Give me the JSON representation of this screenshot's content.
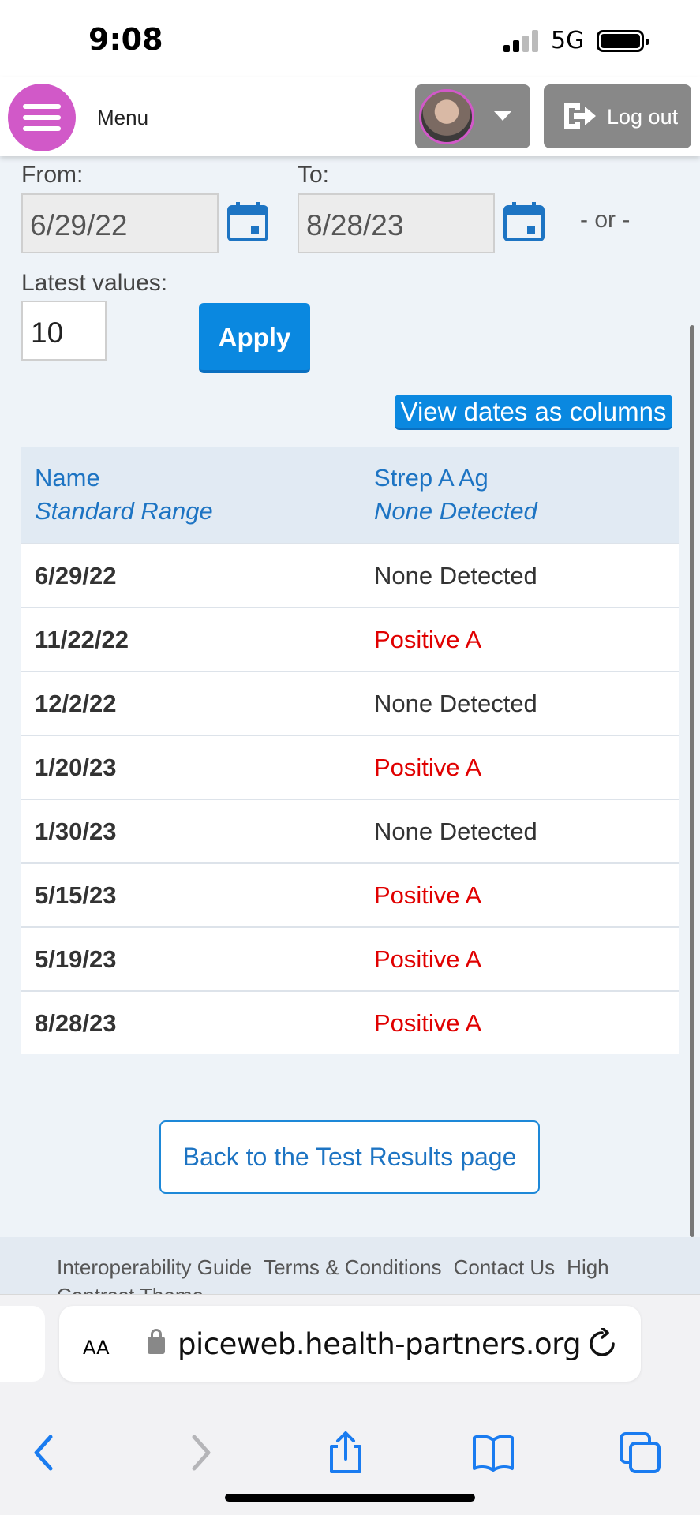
{
  "status_bar": {
    "time": "9:08",
    "network": "5G"
  },
  "header": {
    "menu_label": "Menu",
    "logout_label": "Log out",
    "colors": {
      "menu_button": "#d159c8",
      "header_button": "#888888"
    }
  },
  "filters": {
    "from_label": "From:",
    "from_value": "6/29/22",
    "to_label": "To:",
    "to_value": "8/28/23",
    "or_text": "- or -",
    "latest_label": "Latest values:",
    "latest_value": "10",
    "apply_label": "Apply"
  },
  "view_toggle_label": "View dates as columns",
  "table": {
    "header": {
      "name_label": "Name",
      "name_sub": "Standard Range",
      "test_label": "Strep A Ag",
      "test_sub": "None Detected"
    },
    "rows": [
      {
        "date": "6/29/22",
        "value": "None Detected",
        "abnormal": false
      },
      {
        "date": "11/22/22",
        "value": "Positive A",
        "abnormal": true
      },
      {
        "date": "12/2/22",
        "value": "None Detected",
        "abnormal": false
      },
      {
        "date": "1/20/23",
        "value": "Positive A",
        "abnormal": true
      },
      {
        "date": "1/30/23",
        "value": "None Detected",
        "abnormal": false
      },
      {
        "date": "5/15/23",
        "value": "Positive A",
        "abnormal": true
      },
      {
        "date": "5/19/23",
        "value": "Positive A",
        "abnormal": true
      },
      {
        "date": "8/28/23",
        "value": "Positive A",
        "abnormal": true
      }
    ],
    "colors": {
      "abnormal": "#e00000",
      "header_text": "#1d74c3",
      "accent": "#0a88e0"
    }
  },
  "back_button_label": "Back to the Test Results page",
  "footer": {
    "links": [
      "Interoperability Guide",
      "Terms & Conditions",
      "Contact Us",
      "High Contrast Theme"
    ]
  },
  "browser": {
    "text_size_label": "AA",
    "url": "piceweb.health-partners.org",
    "icons": [
      "back-icon",
      "forward-icon",
      "share-icon",
      "bookmarks-icon",
      "tabs-icon",
      "reload-icon",
      "lock-icon"
    ]
  }
}
